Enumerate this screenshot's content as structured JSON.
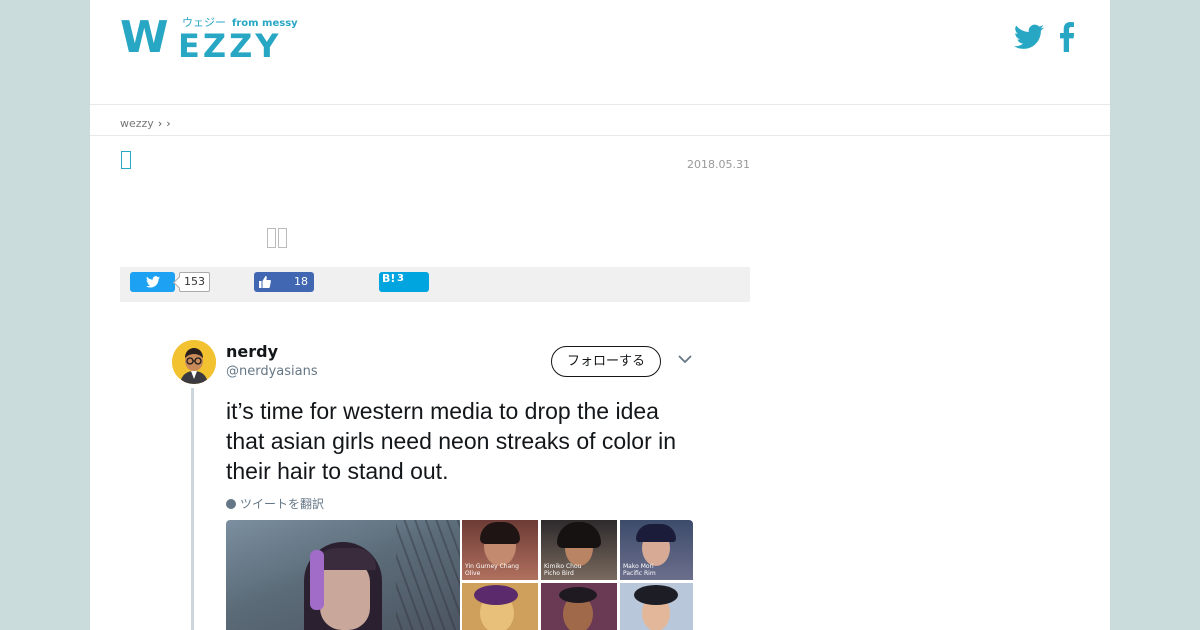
{
  "header": {
    "logo_w": "W",
    "logo_rest": "EZZY",
    "logo_katakana": "ウェジー",
    "logo_from": "from messy",
    "social_icons": [
      "twitter-icon",
      "facebook-icon"
    ]
  },
  "breadcrumb": {
    "home": "wezzy",
    "sep1": "›",
    "sep2": "›"
  },
  "article": {
    "date": "2018.05.31"
  },
  "share": {
    "twitter_count": "153",
    "facebook_count": "18",
    "hatena_label": "B!",
    "hatena_count": "3"
  },
  "tweet": {
    "name": "nerdy",
    "handle": "@nerdyasians",
    "follow_label": "フォローする",
    "text": "it’s time for western media to drop the idea that asian girls need neon streaks of color in their hair to stand out.",
    "translate_label": "ツイートを翻訳",
    "captions": [
      "Yin Gurney Chang\nOlive",
      "Kimiko Chou\nPicho Bird",
      "Mako Mori\nPacific Rim"
    ]
  },
  "colors": {
    "brand": "#27a7c3",
    "twitter": "#1da1f2",
    "facebook": "#4267b2",
    "hatena": "#00a4de",
    "side_background": "#cadcdb"
  }
}
